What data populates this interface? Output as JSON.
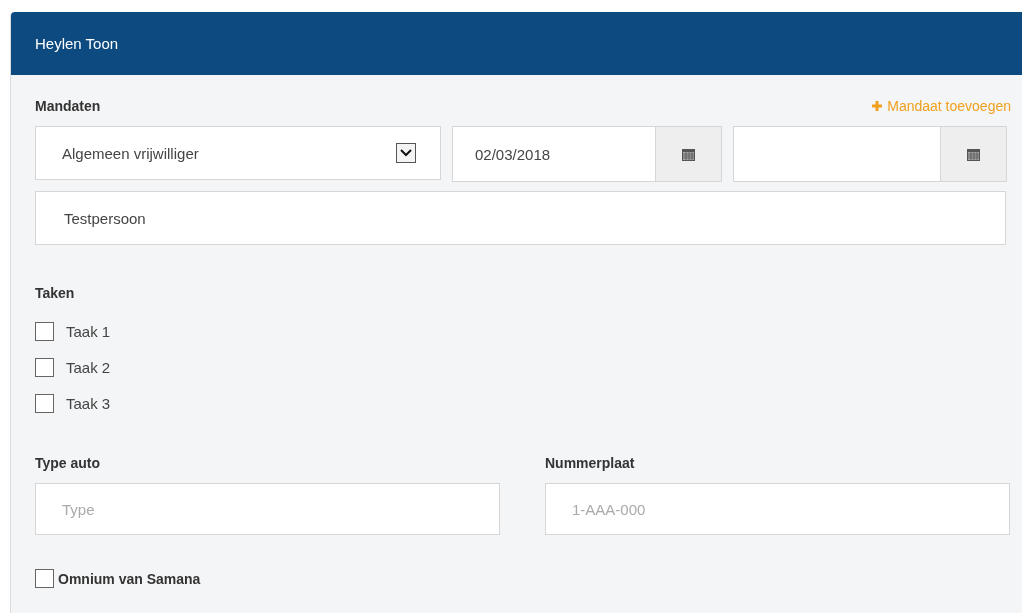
{
  "panel": {
    "title": "Heylen Toon"
  },
  "mandates": {
    "label": "Mandaten",
    "add_link": "Mandaat toevoegen",
    "type_select": {
      "value": "Algemeen vrijwilliger"
    },
    "start_date": {
      "value": "02/03/2018"
    },
    "description": {
      "value": "Testpersoon"
    }
  },
  "tasks": {
    "label": "Taken",
    "items": [
      {
        "label": "Taak 1",
        "checked": false
      },
      {
        "label": "Taak 2",
        "checked": false
      },
      {
        "label": "Taak 3",
        "checked": false
      }
    ]
  },
  "car_type": {
    "label": "Type auto",
    "placeholder": "Type"
  },
  "license_plate": {
    "label": "Nummerplaat",
    "placeholder": "1-AAA-000"
  },
  "omnium": {
    "label": "Omnium van Samana",
    "checked": false
  }
}
